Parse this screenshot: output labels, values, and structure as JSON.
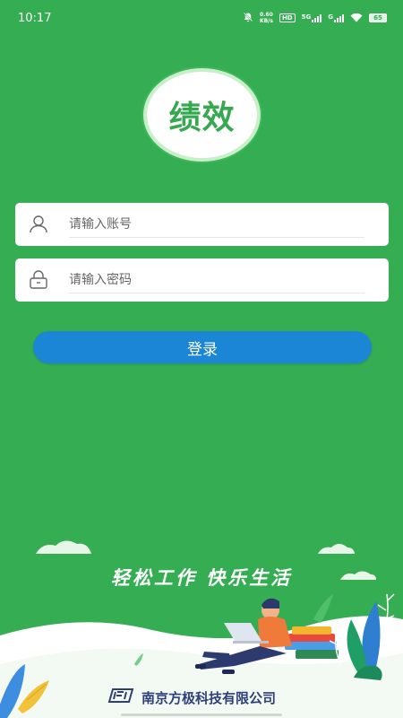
{
  "status": {
    "time": "10:17",
    "net_speed_value": "0.60",
    "net_speed_unit": "KB/s",
    "hd_label": "HD",
    "sig1_label": "5G",
    "sig2_label": "G",
    "battery": "65"
  },
  "app": {
    "logo_text": "绩效"
  },
  "form": {
    "username_placeholder": "请输入账号",
    "password_placeholder": "请输入密码",
    "login_label": "登录"
  },
  "footer": {
    "slogan": "轻松工作 快乐生活",
    "company": "南京方极科技有限公司"
  },
  "colors": {
    "background": "#34ad53",
    "button": "#1b86d6",
    "logo_text": "#36a84f"
  }
}
